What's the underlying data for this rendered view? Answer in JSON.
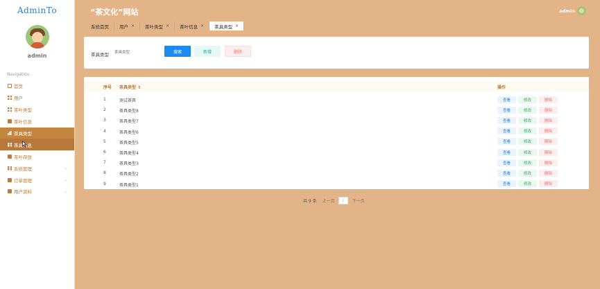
{
  "app": {
    "logo": "AdminTo",
    "site_title": "“茶文化”网站",
    "admin_name": "admin"
  },
  "header": {
    "user": "admin"
  },
  "sidebar": {
    "nav_title": "Navigation",
    "items": [
      {
        "label": "首页",
        "icon": "home-icon"
      },
      {
        "label": "用户",
        "icon": "grid-icon"
      },
      {
        "label": "茶叶类型",
        "icon": "grid-icon"
      },
      {
        "label": "茶叶信息",
        "icon": "box-icon"
      },
      {
        "label": "茶具类型",
        "icon": "bar-chart-icon",
        "active": true
      },
      {
        "label": "茶具信息",
        "icon": "grid-icon",
        "hover": true
      },
      {
        "label": "茶叶存放",
        "icon": "box-icon"
      },
      {
        "label": "系统管理",
        "icon": "grid-icon",
        "has_children": true
      },
      {
        "label": "订单管理",
        "icon": "box-icon",
        "has_children": true
      },
      {
        "label": "用户资料",
        "icon": "box-icon",
        "has_children": true
      }
    ],
    "chevron": "⌄"
  },
  "tabs": [
    {
      "label": "系统首页",
      "closable": false
    },
    {
      "label": "用户",
      "closable": true
    },
    {
      "label": "茶叶类型",
      "closable": true
    },
    {
      "label": "茶叶信息",
      "closable": true
    },
    {
      "label": "茶具类型",
      "closable": true,
      "active": true
    }
  ],
  "tab_close": "×",
  "search": {
    "label": "茶具类型",
    "placeholder": "茶具类型",
    "search_button": "搜索",
    "add_button": "新增",
    "delete_button": "删除"
  },
  "table": {
    "headers": {
      "index": "序号",
      "type": "茶具类型",
      "sort": "⇕",
      "ops": "操作"
    },
    "rows": [
      {
        "index": "1",
        "type": "测试茶具"
      },
      {
        "index": "2",
        "type": "茶具类型8"
      },
      {
        "index": "3",
        "type": "茶具类型7"
      },
      {
        "index": "4",
        "type": "茶具类型6"
      },
      {
        "index": "5",
        "type": "茶具类型5"
      },
      {
        "index": "6",
        "type": "茶具类型4"
      },
      {
        "index": "7",
        "type": "茶具类型3"
      },
      {
        "index": "8",
        "type": "茶具类型2"
      },
      {
        "index": "9",
        "type": "茶具类型1"
      }
    ],
    "op_view": "查看",
    "op_edit": "修改",
    "op_delete": "删除"
  },
  "pagination": {
    "total": "共 9 条",
    "prev": "上一页",
    "page": "1",
    "next": "下一页"
  },
  "colors": {
    "theme": "#e4b489",
    "active_nav": "#c3863f",
    "primary": "#1a8cf0"
  }
}
